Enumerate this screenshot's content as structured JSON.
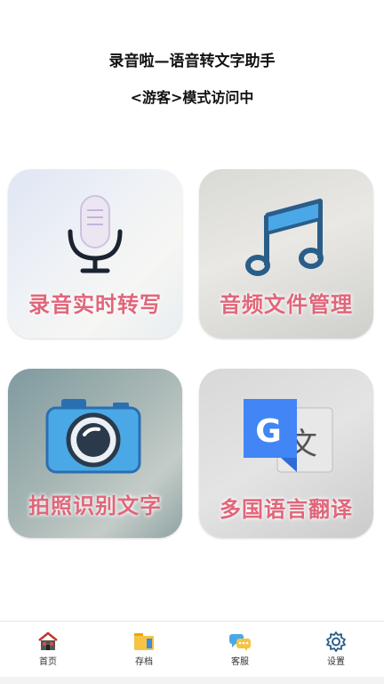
{
  "header": {
    "title": "录音啦—语音转文字助手",
    "subtitle": "<游客>模式访问中"
  },
  "cards": [
    {
      "label": "录音实时转写",
      "icon": "microphone-icon"
    },
    {
      "label": "音频文件管理",
      "icon": "music-note-icon"
    },
    {
      "label": "拍照识别文字",
      "icon": "camera-icon"
    },
    {
      "label": "多国语言翻译",
      "icon": "translate-icon"
    }
  ],
  "tabbar": {
    "items": [
      {
        "label": "首页",
        "icon": "home-icon"
      },
      {
        "label": "存档",
        "icon": "archive-icon"
      },
      {
        "label": "客服",
        "icon": "customer-service-icon"
      },
      {
        "label": "设置",
        "icon": "gear-icon"
      }
    ]
  },
  "colors": {
    "card_label": "#e0667a",
    "camera_blue": "#4aa8e6",
    "google_blue": "#4285f4",
    "music_blue": "#2a5e8a"
  }
}
